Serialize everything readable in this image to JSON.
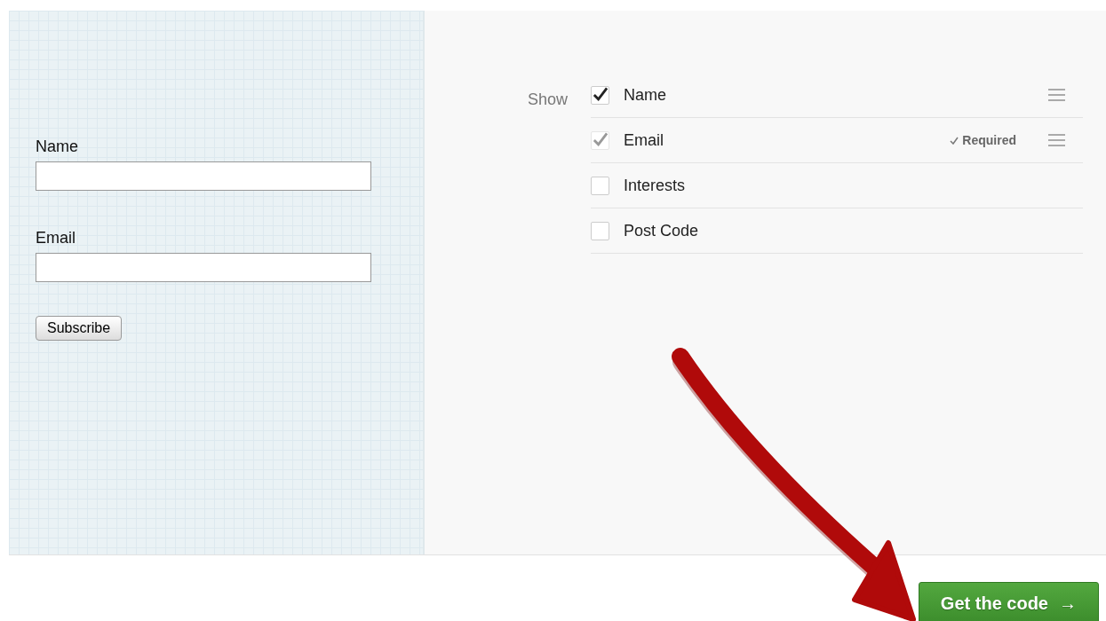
{
  "preview_form": {
    "fields": [
      {
        "label": "Name"
      },
      {
        "label": "Email"
      }
    ],
    "submit_button": "Subscribe"
  },
  "field_options": {
    "label": "Show",
    "items": [
      {
        "label": "Name",
        "checked": true,
        "disabled": false,
        "draggable": true
      },
      {
        "label": "Email",
        "checked": true,
        "disabled": true,
        "required_note": "Required",
        "draggable": true
      },
      {
        "label": "Interests",
        "checked": false,
        "disabled": false,
        "draggable": false
      },
      {
        "label": "Post Code",
        "checked": false,
        "disabled": false,
        "draggable": false
      }
    ]
  },
  "get_code_button": {
    "label": "Get the code",
    "arrow": "→"
  }
}
